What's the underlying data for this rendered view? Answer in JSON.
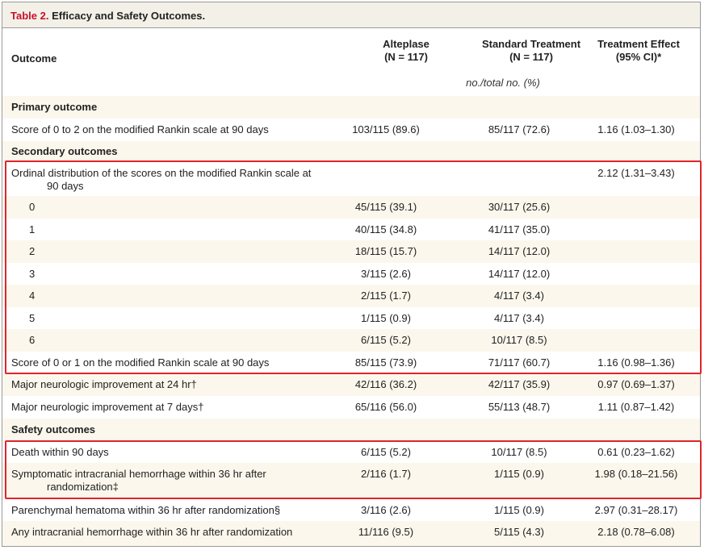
{
  "table": {
    "label": "Table 2.",
    "title": "Efficacy and Safety Outcomes.",
    "headers": {
      "outcome": "Outcome",
      "alteplase": "Alteplase",
      "alteplase_n": "(N = 117)",
      "standard": "Standard Treatment",
      "standard_n": "(N = 117)",
      "effect": "Treatment Effect",
      "effect_ci": "(95% CI)*"
    },
    "units": "no./total no. (%)",
    "sections": {
      "primary": "Primary outcome",
      "secondary": "Secondary outcomes",
      "safety": "Safety outcomes"
    },
    "rows": [
      {
        "outcome": "Score of 0 to 2 on the modified Rankin scale at 90 days",
        "alteplase": "103/115 (89.6)",
        "standard": "85/117 (72.6)",
        "effect": "1.16 (1.03–1.30)"
      },
      {
        "outcome_line1": "Ordinal distribution of the scores on the modified Rankin scale at",
        "outcome_line2": "90 days",
        "alteplase": "",
        "standard": "",
        "effect": "2.12 (1.31–3.43)"
      },
      {
        "outcome": "0",
        "alteplase": "45/115 (39.1)",
        "standard": "30/117 (25.6)",
        "effect": ""
      },
      {
        "outcome": "1",
        "alteplase": "40/115 (34.8)",
        "standard": "41/117 (35.0)",
        "effect": ""
      },
      {
        "outcome": "2",
        "alteplase": "18/115 (15.7)",
        "standard": "14/117 (12.0)",
        "effect": ""
      },
      {
        "outcome": "3",
        "alteplase": "3/115 (2.6)",
        "standard": "14/117 (12.0)",
        "effect": ""
      },
      {
        "outcome": "4",
        "alteplase": "2/115 (1.7)",
        "standard": "4/117 (3.4)",
        "effect": ""
      },
      {
        "outcome": "5",
        "alteplase": "1/115 (0.9)",
        "standard": "4/117 (3.4)",
        "effect": ""
      },
      {
        "outcome": "6",
        "alteplase": "6/115 (5.2)",
        "standard": "10/117 (8.5)",
        "effect": ""
      },
      {
        "outcome": "Score of 0 or 1 on the modified Rankin scale at 90 days",
        "alteplase": "85/115 (73.9)",
        "standard": "71/117 (60.7)",
        "effect": "1.16 (0.98–1.36)"
      },
      {
        "outcome": "Major neurologic improvement at 24 hr†",
        "alteplase": "42/116 (36.2)",
        "standard": "42/117 (35.9)",
        "effect": "0.97 (0.69–1.37)"
      },
      {
        "outcome": "Major neurologic improvement at 7 days†",
        "alteplase": "65/116 (56.0)",
        "standard": "55/113 (48.7)",
        "effect": "1.11 (0.87–1.42)"
      },
      {
        "outcome": "Death within 90 days",
        "alteplase": "6/115 (5.2)",
        "standard": "10/117 (8.5)",
        "effect": "0.61 (0.23–1.62)"
      },
      {
        "outcome_line1": "Symptomatic intracranial hemorrhage within 36 hr after",
        "outcome_line2": "randomization‡",
        "alteplase": "2/116 (1.7)",
        "standard": "1/115 (0.9)",
        "effect": "1.98 (0.18–21.56)"
      },
      {
        "outcome": "Parenchymal hematoma within 36 hr after randomization§",
        "alteplase": "3/116 (2.6)",
        "standard": "1/115 (0.9)",
        "effect": "2.97 (0.31–28.17)"
      },
      {
        "outcome": "Any intracranial hemorrhage within 36 hr after randomization",
        "alteplase": "11/116 (9.5)",
        "standard": "5/115 (4.3)",
        "effect": "2.18 (0.78–6.08)"
      }
    ]
  },
  "colors": {
    "label_red": "#c8102e",
    "shade": "#fbf7ec",
    "highlight": "#e0242b"
  }
}
